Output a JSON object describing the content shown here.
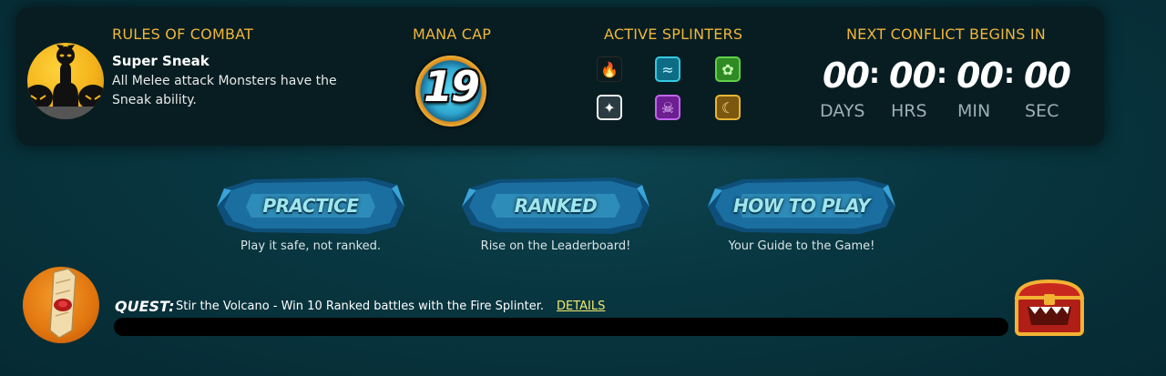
{
  "rules": {
    "header": "RULES OF COMBAT",
    "name": "Super Sneak",
    "description": "All Melee attack Monsters have the Sneak ability."
  },
  "mana": {
    "header": "MANA CAP",
    "value": "19"
  },
  "splinters": {
    "header": "ACTIVE SPLINTERS",
    "items": [
      {
        "name": "fire",
        "active": false,
        "color": "#4a4a4a"
      },
      {
        "name": "water",
        "active": true,
        "color": "#2ab7d3"
      },
      {
        "name": "earth",
        "active": true,
        "color": "#3fa83a"
      },
      {
        "name": "life",
        "active": true,
        "color": "#e8e8e8"
      },
      {
        "name": "death",
        "active": true,
        "color": "#9b3fc4"
      },
      {
        "name": "dragon",
        "active": true,
        "color": "#d8a21c"
      }
    ]
  },
  "timer": {
    "header": "NEXT CONFLICT BEGINS IN",
    "days": "00",
    "hrs": "00",
    "min": "00",
    "sec": "00",
    "sep": ":",
    "days_label": "DAYS",
    "hrs_label": "HRS",
    "min_label": "MIN",
    "sec_label": "SEC"
  },
  "modes": [
    {
      "label": "PRACTICE",
      "subtitle": "Play it safe, not ranked."
    },
    {
      "label": "RANKED",
      "subtitle": "Rise on the Leaderboard!"
    },
    {
      "label": "HOW TO PLAY",
      "subtitle": "Your Guide to the Game!"
    }
  ],
  "quest": {
    "label": "QUEST:",
    "text": "Stir the Volcano - Win 10 Ranked battles with the Fire Splinter.",
    "details_link": "DETAILS",
    "progress": 0
  },
  "colors": {
    "header_gold": "#f0b63a",
    "panel_bg": "#071d22",
    "page_bg": "#083640",
    "details_link": "#f3ea6a"
  }
}
